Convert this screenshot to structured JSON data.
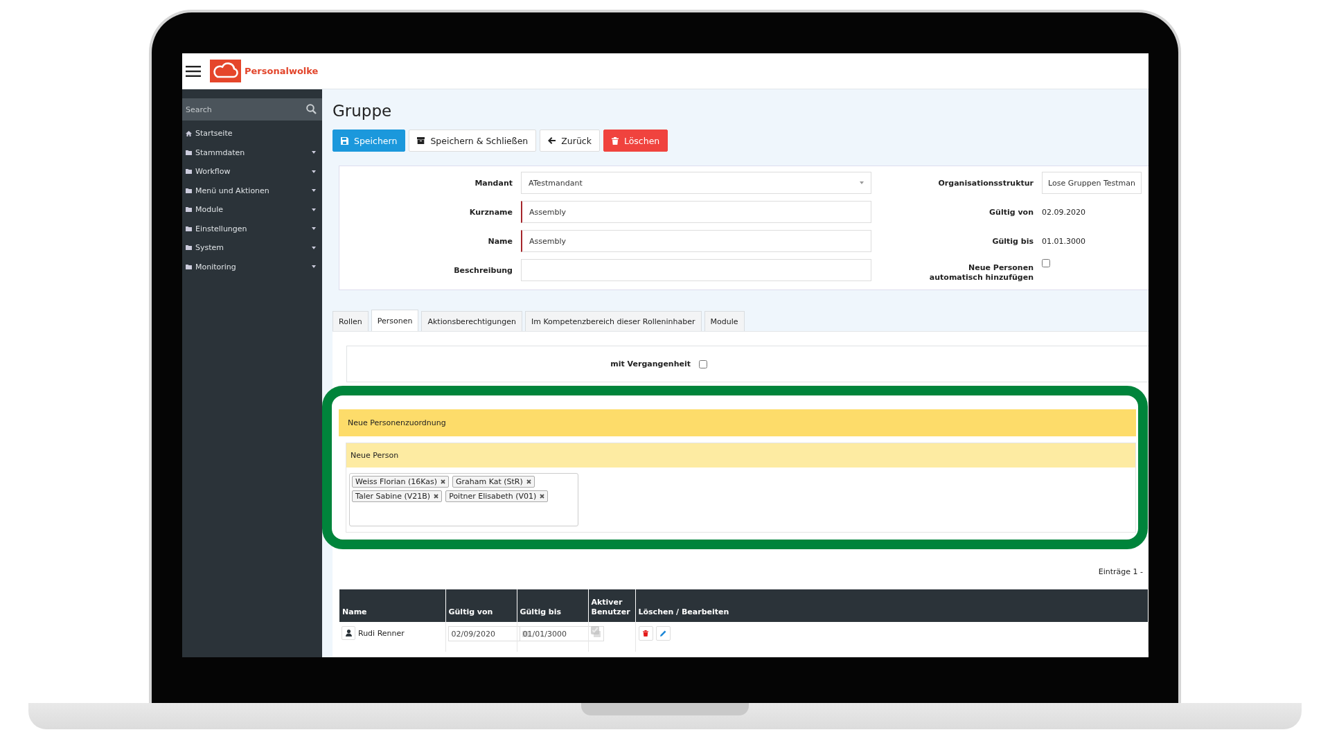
{
  "app": {
    "name": "Personalwolke"
  },
  "sidebar": {
    "search_placeholder": "Search",
    "items": [
      {
        "label": "Startseite",
        "kind": "home"
      },
      {
        "label": "Stammdaten",
        "kind": "folder"
      },
      {
        "label": "Workflow",
        "kind": "folder"
      },
      {
        "label": "Menü und Aktionen",
        "kind": "folder"
      },
      {
        "label": "Module",
        "kind": "folder"
      },
      {
        "label": "Einstellungen",
        "kind": "folder"
      },
      {
        "label": "System",
        "kind": "folder"
      },
      {
        "label": "Monitoring",
        "kind": "folder"
      }
    ]
  },
  "page": {
    "title": "Gruppe",
    "buttons": [
      {
        "label": "Speichern",
        "kind": "save"
      },
      {
        "label": "Speichern & Schließen",
        "kind": "save-close"
      },
      {
        "label": "Zurück",
        "kind": "back"
      },
      {
        "label": "Löschen",
        "kind": "delete"
      }
    ]
  },
  "form": {
    "left": [
      {
        "label": "Mandant",
        "kind": "select",
        "value": "ATestmandant"
      },
      {
        "label": "Kurzname",
        "kind": "required",
        "value": "Assembly"
      },
      {
        "label": "Name",
        "kind": "required",
        "value": "Assembly"
      },
      {
        "label": "Beschreibung",
        "kind": "text"
      }
    ],
    "right": [
      {
        "label": "Organisationsstruktur",
        "kind": "field",
        "value": "Lose Gruppen Testman"
      },
      {
        "label": "Gültig von",
        "kind": "value",
        "value": "02.09.2020"
      },
      {
        "label": "Gültig bis",
        "kind": "value",
        "value": "01.01.3000"
      },
      {
        "label": "Neue Personen automatisch hinzufügen",
        "kind": "checkbox",
        "checked": false
      }
    ]
  },
  "tabs": [
    {
      "label": "Rollen",
      "selected": false
    },
    {
      "label": "Personen",
      "selected": true
    },
    {
      "label": "Aktionsberechtigungen",
      "selected": false
    },
    {
      "label": "Im Kompetenzbereich dieser Rolleninhaber",
      "selected": false
    },
    {
      "label": "Module",
      "selected": false
    }
  ],
  "history_filter": {
    "label": "mit Vergangenheit",
    "checked": false
  },
  "assignment": {
    "highlighted": true,
    "title": "Neue Personenzuordnung",
    "subtitle": "Neue Person",
    "tags": [
      "Weiss Florian (16Kas)",
      "Graham Kat (StR)",
      "Taler Sabine (V21B)",
      "Poitner Elisabeth (V01)"
    ]
  },
  "entries_info": "Einträge 1 -",
  "table": {
    "columns": [
      "Name",
      "Gültig von",
      "Gültig bis",
      "Aktiver Benutzer",
      "Löschen / Bearbeiten"
    ],
    "rows": [
      {
        "name": "Rudi Renner",
        "valid_from": "02/09/2020",
        "valid_to": "01/01/3000",
        "active": true
      }
    ]
  }
}
